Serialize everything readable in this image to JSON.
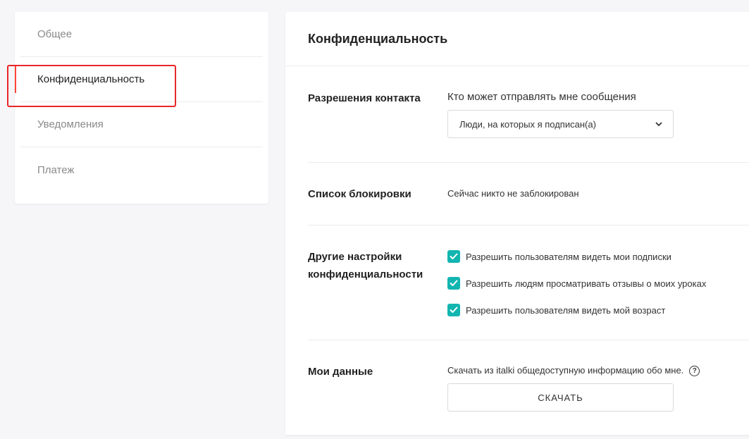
{
  "sidebar": {
    "items": [
      {
        "label": "Общее"
      },
      {
        "label": "Конфиденциальность"
      },
      {
        "label": "Уведомления"
      },
      {
        "label": "Платеж"
      }
    ]
  },
  "main": {
    "title": "Конфиденциальность",
    "contact": {
      "label": "Разрешения контакта",
      "description": "Кто может отправлять мне сообщения",
      "selected": "Люди, на которых я подписан(а)"
    },
    "blocklist": {
      "label": "Список блокировки",
      "text": "Сейчас никто не заблокирован"
    },
    "other": {
      "label_line1": "Другие настройки",
      "label_line2": "конфиденциальности",
      "options": [
        {
          "label": "Разрешить пользователям видеть мои подписки",
          "checked": true
        },
        {
          "label": "Разрешить людям просматривать отзывы о моих уроках",
          "checked": true
        },
        {
          "label": "Разрешить пользователям видеть мой возраст",
          "checked": true
        }
      ]
    },
    "mydata": {
      "label": "Мои данные",
      "description": "Скачать из italki общедоступную информацию обо мне.",
      "help": "?",
      "button": "СКАЧАТЬ"
    }
  },
  "colors": {
    "accent": "#12b5b0",
    "active_marker": "#ff4438",
    "highlight": "#e8262b"
  }
}
